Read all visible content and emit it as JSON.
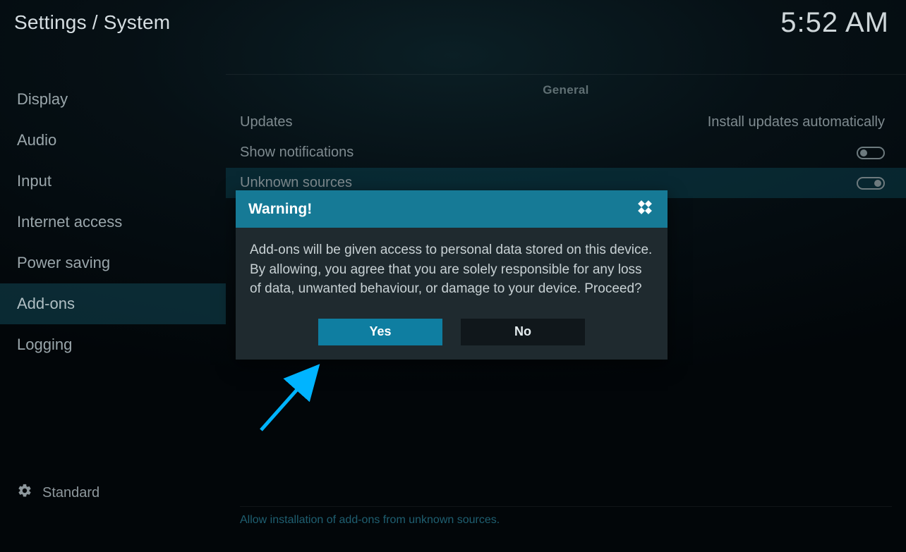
{
  "breadcrumb": "Settings / System",
  "clock": "5:52 AM",
  "sidebar": {
    "items": [
      {
        "label": "Display",
        "selected": false
      },
      {
        "label": "Audio",
        "selected": false
      },
      {
        "label": "Input",
        "selected": false
      },
      {
        "label": "Internet access",
        "selected": false
      },
      {
        "label": "Power saving",
        "selected": false
      },
      {
        "label": "Add-ons",
        "selected": true
      },
      {
        "label": "Logging",
        "selected": false
      }
    ],
    "level_label": "Standard",
    "level_icon": "gear-icon"
  },
  "main": {
    "section": "General",
    "rows": [
      {
        "label": "Updates",
        "value": "Install updates automatically",
        "type": "value",
        "highlight": false
      },
      {
        "label": "Show notifications",
        "value": null,
        "type": "toggle",
        "on": false,
        "highlight": false
      },
      {
        "label": "Unknown sources",
        "value": null,
        "type": "toggle",
        "on": true,
        "highlight": true
      }
    ],
    "footer_hint": "Allow installation of add-ons from unknown sources."
  },
  "dialog": {
    "title": "Warning!",
    "icon": "kodi-logo-icon",
    "body": "Add-ons will be given access to personal data stored on this device. By allowing, you agree that you are solely responsible for any loss of data, unwanted behaviour, or damage to your device. Proceed?",
    "yes_label": "Yes",
    "no_label": "No"
  }
}
